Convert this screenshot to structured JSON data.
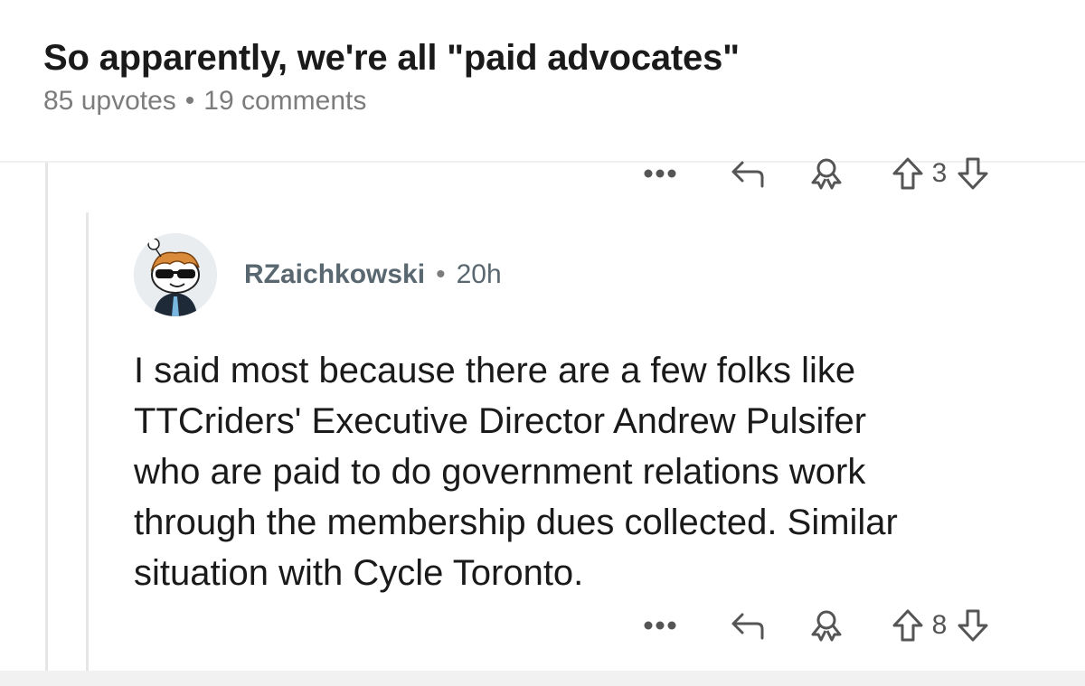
{
  "post": {
    "title": "So apparently, we're all \"paid advocates\"",
    "upvotes_label": "85 upvotes",
    "separator": "•",
    "comments_label": "19 comments"
  },
  "parent_actions": {
    "more_icon": "more-icon",
    "reply_icon": "reply-icon",
    "award_icon": "award-icon",
    "upvote_icon": "upvote-icon",
    "vote_count": "3",
    "downvote_icon": "downvote-icon"
  },
  "comment": {
    "username": "RZaichkowski",
    "separator": "•",
    "time": "20h",
    "avatar_icon": "snoo-avatar-sunglasses",
    "body_lines": [
      "I said most because there are a few folks like",
      "TTCriders' Executive Director Andrew Pulsifer",
      "who are paid to do government relations work",
      "through the membership dues collected. Similar",
      "situation with Cycle Toronto."
    ],
    "actions": {
      "more_icon": "more-icon",
      "reply_icon": "reply-icon",
      "award_icon": "award-icon",
      "upvote_icon": "upvote-icon",
      "vote_count": "8",
      "downvote_icon": "downvote-icon"
    }
  }
}
